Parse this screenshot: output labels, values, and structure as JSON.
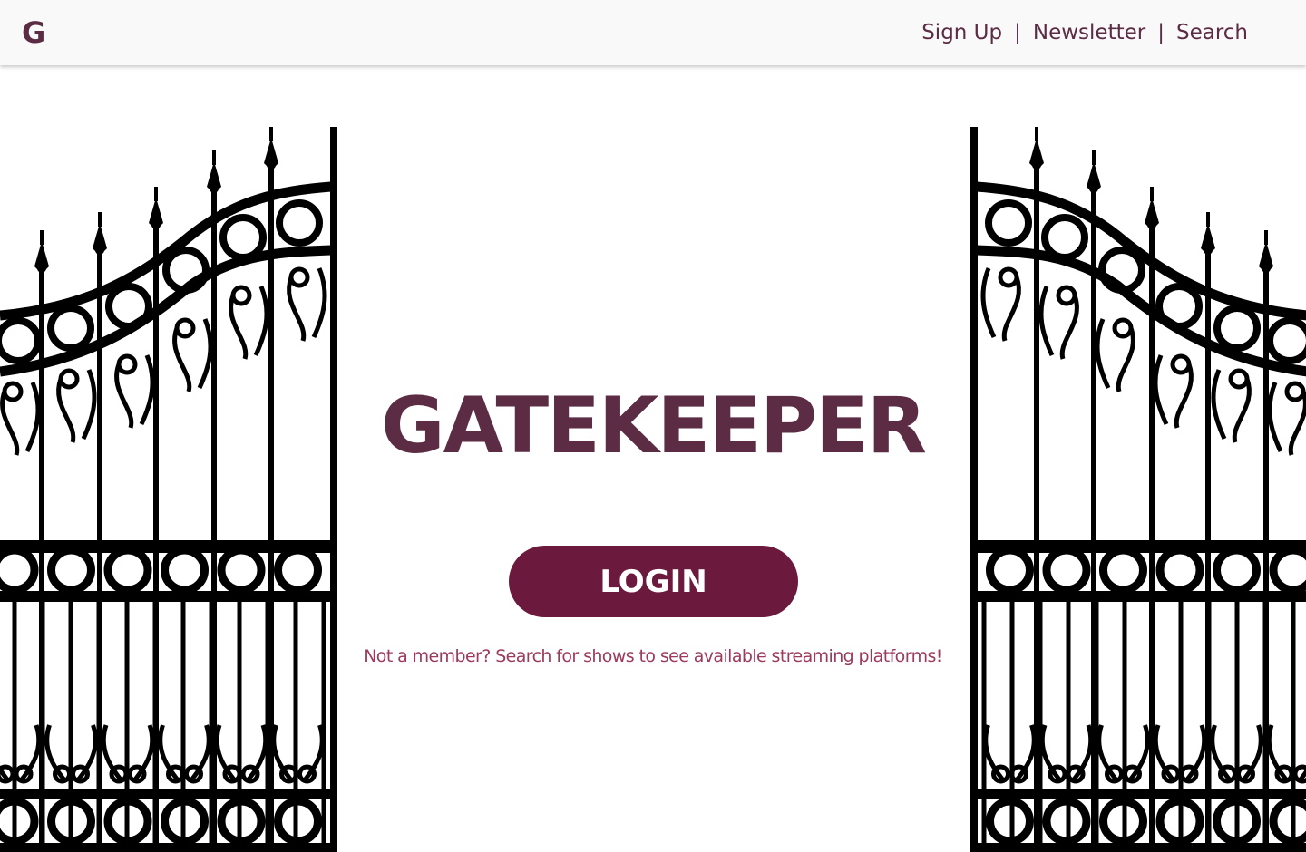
{
  "header": {
    "logo": "G",
    "nav": [
      {
        "label": "Sign Up"
      },
      {
        "label": "Newsletter"
      },
      {
        "label": "Search"
      }
    ],
    "separator": "|"
  },
  "hero": {
    "title": "GATEKEEPER",
    "login_label": "LOGIN",
    "member_link": "Not a member? Search for shows to see available streaming platforms!"
  },
  "colors": {
    "brand": "#5b2c44",
    "button": "#6b1a3d",
    "link": "#9b3a5c",
    "gate": "#000000"
  },
  "decor": {
    "gate_left_icon": "iron-gate-icon",
    "gate_right_icon": "iron-gate-icon"
  }
}
